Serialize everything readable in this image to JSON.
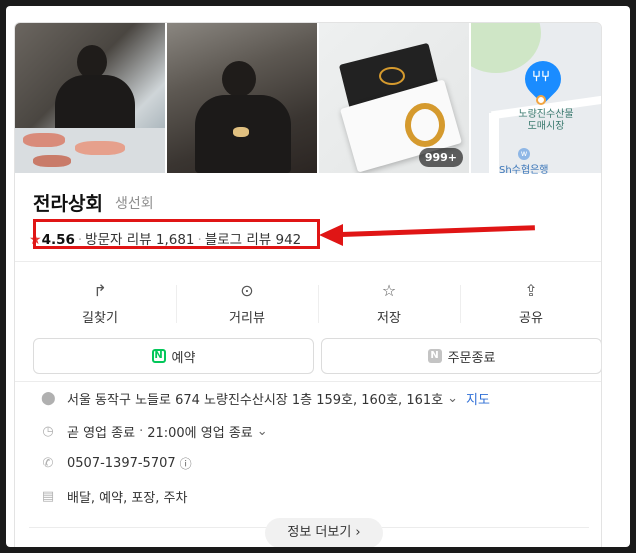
{
  "place": {
    "name": "전라상회",
    "category": "생선회",
    "rating": "4.56",
    "visitor_reviews_label": "방문자 리뷰 1,681",
    "blog_reviews_label": "블로그 리뷰 942"
  },
  "photos": {
    "count_badge": "999+",
    "map_poi_label_line1": "노량진수산물",
    "map_poi_label_line2": "도매시장",
    "map_bank_label": "Sh수협은행",
    "map_bank_icon": "w"
  },
  "actions": [
    {
      "label": "길찾기",
      "icon": "directions-icon"
    },
    {
      "label": "거리뷰",
      "icon": "street-view-icon"
    },
    {
      "label": "저장",
      "icon": "star-outline-icon"
    },
    {
      "label": "공유",
      "icon": "share-icon"
    }
  ],
  "buttons": {
    "reserve": "예약",
    "reserve_icon_letter": "N",
    "order_closed": "주문종료",
    "order_icon_letter": "N"
  },
  "info": {
    "address": "서울 동작구 노들로 674 노량진수산시장 1층 159호, 160호, 161호",
    "map_link": "지도",
    "status": "곧 영업 종료",
    "hours": "21:00에 영업 종료",
    "phone": "0507-1397-5707",
    "services": "배달, 예약, 포장, 주차"
  },
  "more_button": "정보 더보기 ›",
  "colors": {
    "highlight_red": "#e01515",
    "link_blue": "#2f6fd6",
    "naver_green": "#03c75a",
    "star_red": "#e53935"
  }
}
